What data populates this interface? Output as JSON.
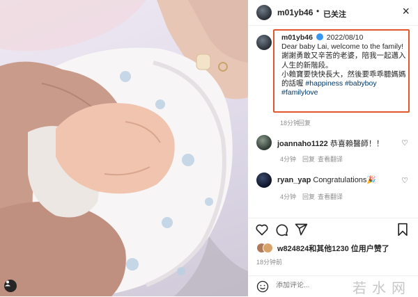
{
  "header": {
    "username": "m01yb46",
    "dot": "•",
    "follow_status": "已关注",
    "close_icon": "×"
  },
  "caption": {
    "username": "m01yb46",
    "date": "2022/08/10",
    "line1": "Dear baby Lai, welcome to the family!",
    "line2": "謝謝勇敢又辛苦的老婆，陪我一起邁入人生的新階段。",
    "line3": "小賴寶要快快長大，然後要乖乖聽媽媽的話喔",
    "hashtags": "#happiness #babyboy #familylove",
    "time": "18分钟",
    "reply": "回复"
  },
  "comments": [
    {
      "username": "joannaho1122",
      "text": "恭喜賴醫師！！",
      "time": "4分钟",
      "reply": "回复",
      "translate": "查看翻译"
    },
    {
      "username": "ryan_yap",
      "text": "Congratulations🎉",
      "time": "4分钟",
      "reply": "回复",
      "translate": "查看翻译"
    }
  ],
  "likes": {
    "text": "w824824和其他1230 位用户赞了"
  },
  "post_time": "18分钟前",
  "add_comment": {
    "placeholder": "添加评论..."
  },
  "watermark": "若水网",
  "colors": {
    "caption_border": "#e2562d",
    "verified": "#3897f0",
    "hashtag": "#00376b",
    "meta": "#8e8e8e"
  },
  "icons": [
    "close-icon",
    "verified-icon",
    "heart-icon",
    "comment-icon",
    "share-icon",
    "bookmark-icon",
    "smile-icon"
  ]
}
